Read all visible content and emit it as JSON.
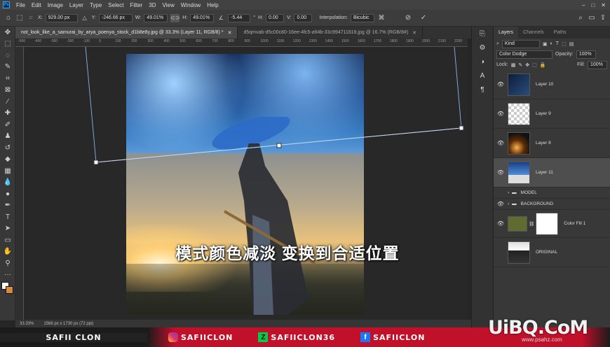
{
  "menu": {
    "items": [
      "File",
      "Edit",
      "Image",
      "Layer",
      "Type",
      "Select",
      "Filter",
      "3D",
      "View",
      "Window",
      "Help"
    ]
  },
  "options": {
    "x_value": "929.00 px",
    "y_label": "Y:",
    "y_value": "-246.66 px",
    "w_label": "W:",
    "w_value": "49.01%",
    "h_label": "H:",
    "h_value": "49.01%",
    "angle_value": "-5.44",
    "hskew_label": "H:",
    "hskew_value": "0.00",
    "vskew_label": "V:",
    "vskew_value": "0.00",
    "interp_label": "Interpolation:",
    "interp_value": "Bicubic"
  },
  "tabs": [
    {
      "label": "not_look_like_a_samurai_by_arya_poenya_stock_d1b8e8y.jpg @ 33.3% (Layer 11, RGB/8) *"
    },
    {
      "label": "d5qmvab-d5c00c80-16ee-4fc5-a94b-33c994711818.jpg @ 16.7% (RGB/8#)"
    }
  ],
  "ruler": {
    "marks": [
      "-500",
      "-400",
      "-300",
      "-200",
      "-100",
      "0",
      "100",
      "200",
      "300",
      "400",
      "500",
      "600",
      "700",
      "800",
      "900",
      "1000",
      "1100",
      "1200",
      "1300",
      "1400",
      "1500",
      "1600",
      "1700",
      "1800",
      "1900",
      "2000",
      "2100",
      "2200"
    ]
  },
  "subtitle": "模式颜色减淡 变换到合适位置",
  "status": {
    "zoom": "33.33%",
    "doc_info": "1568 px x 1730 px (72 ppi)"
  },
  "panel": {
    "tabs": [
      "Layers",
      "Channels",
      "Paths"
    ],
    "kind_label": "Kind",
    "blend_mode": "Color Dodge",
    "opacity_label": "Opacity:",
    "opacity_value": "100%",
    "lock_label": "Lock:",
    "fill_label": "Fill:",
    "fill_value": "100%",
    "layers": [
      {
        "name": "Layer 10"
      },
      {
        "name": "Layer 9"
      },
      {
        "name": "Layer 8"
      },
      {
        "name": "Layer 11"
      },
      {
        "name": "MODEL"
      },
      {
        "name": "BACKGROUND"
      },
      {
        "name": "Color Fill 1"
      },
      {
        "name": "ORIGINAL"
      }
    ]
  },
  "social": {
    "brand": "SAFII CLON",
    "handles": [
      "SAFIICLON",
      "SAFIICLON36",
      "SAFIICLON"
    ]
  },
  "watermark": {
    "main": "UiBQ.CoM",
    "sub": "www.psahz.com"
  },
  "colors": {
    "accent": "#31a8ff",
    "social_red": "#c0102a"
  }
}
